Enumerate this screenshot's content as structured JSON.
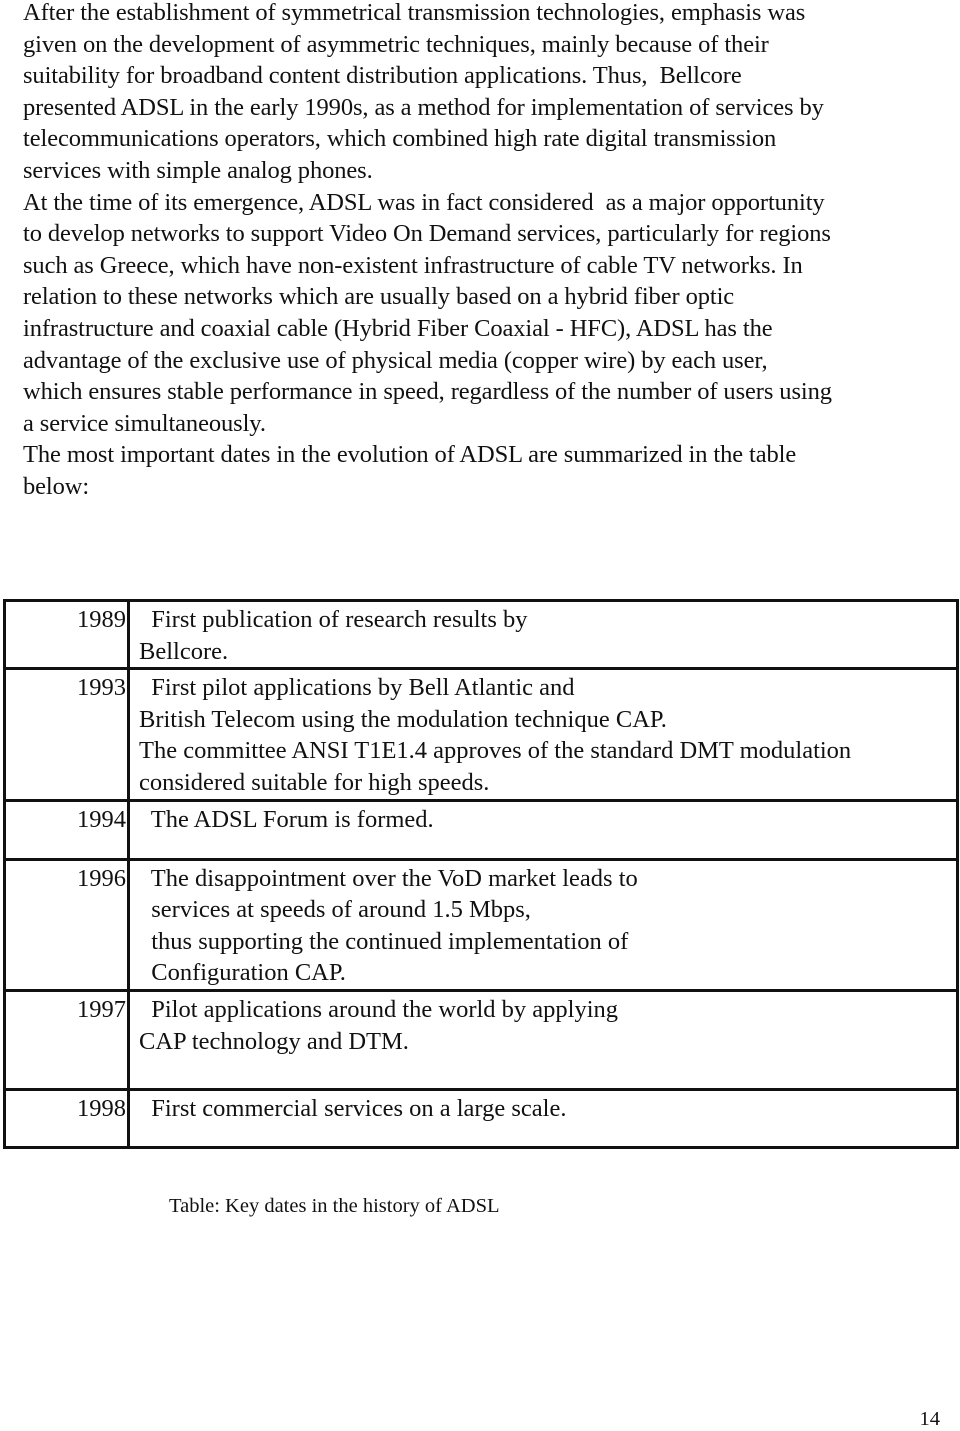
{
  "document": {
    "paragraphs": [
      {
        "lines": [
          "After the establishment of symmetrical transmission technologies, emphasis was",
          "given on the development of asymmetric techniques, mainly because of their",
          "suitability for broadband content distribution applications. Thus,  Bellcore",
          "presented ADSL in the early 1990s, as a method for implementation of services by",
          "telecommunications operators, which combined high rate digital transmission",
          "services with simple analog phones."
        ]
      },
      {
        "lines": [
          "At the time of its emergence, ADSL was in fact considered  as a major opportunity",
          "to develop networks to support Video On Demand services, particularly for regions",
          "such as Greece, which have non-existent infrastructure of cable TV networks. In",
          "relation to these networks which are usually based on a hybrid fiber optic",
          "infrastructure and coaxial cable (Hybrid Fiber Coaxial - HFC), ADSL has the",
          "advantage of the exclusive use of physical media (copper wire) by each user,",
          "which ensures stable performance in speed, regardless of the number of users using",
          "a service simultaneously."
        ]
      },
      {
        "lines": [
          "The most important dates in the evolution of ADSL are summarized in the table",
          "below:"
        ]
      }
    ],
    "table": {
      "rows": [
        {
          "year": "1989",
          "lines": [
            "  First publication of research results by",
            "Bellcore."
          ]
        },
        {
          "year": "1993",
          "lines": [
            "  First pilot applications by Bell Atlantic and",
            "British Telecom using the modulation technique CAP.",
            "The committee ANSI T1E1.4 approves of the standard DMT modulation",
            "considered suitable for high speeds."
          ]
        },
        {
          "year": "1994",
          "lines": [
            "  The ADSL Forum is formed."
          ]
        },
        {
          "year": "1996",
          "lines": [
            "  The disappointment over the VoD market leads to",
            "  services at speeds of around 1.5 Mbps,",
            "  thus supporting the continued implementation of",
            "  Configuration CAP."
          ]
        },
        {
          "year": "1997",
          "lines": [
            "  Pilot applications around the world by applying",
            "CAP technology and DTM."
          ]
        },
        {
          "year": "1998",
          "lines": [
            "  First commercial services on a large scale."
          ]
        }
      ]
    },
    "caption": "Table: Key dates in the history of ADSL",
    "page_number": "14"
  }
}
